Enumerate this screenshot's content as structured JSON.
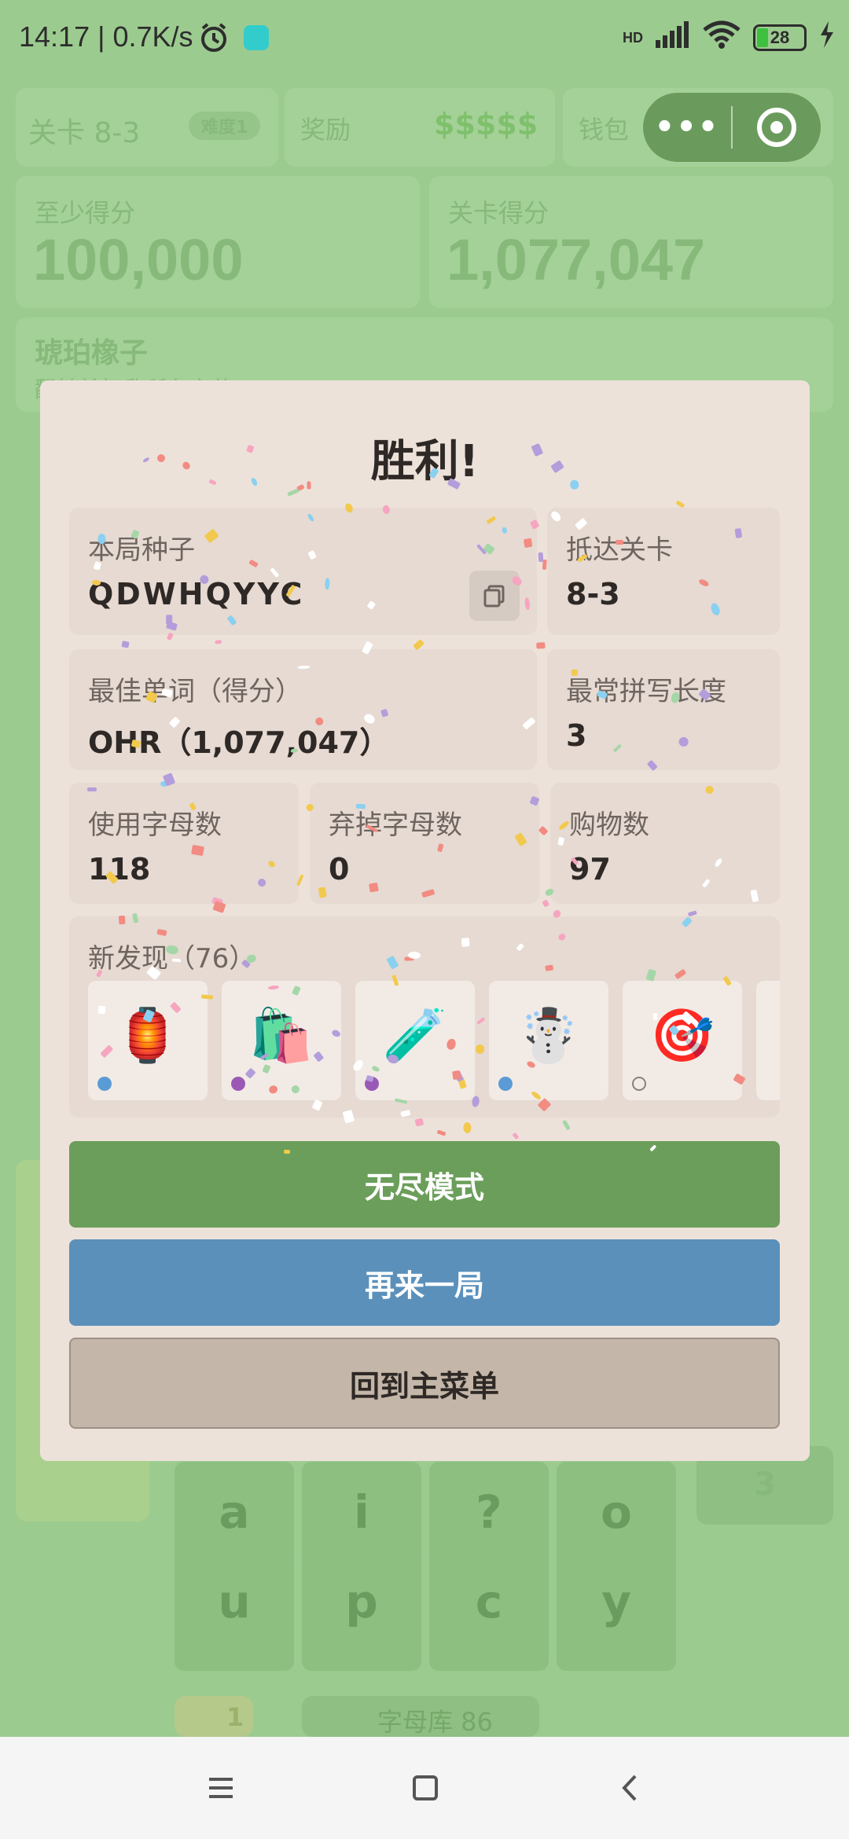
{
  "status": {
    "time": "14:17 | 0.7K/s",
    "hd": "HD",
    "battery": "28"
  },
  "background": {
    "level_label": "关卡 8-3",
    "difficulty": "难度1",
    "reward_label": "奖励",
    "reward_value": "$$$$$",
    "wallet_label": "钱包",
    "min_score_label": "至少得分",
    "min_score_value": "100,000",
    "level_score_label": "关卡得分",
    "level_score_value": "1,077,047",
    "item_name": "琥珀橡子",
    "item_desc": "翻转并打乱所有字节",
    "tiles": [
      "a",
      "i",
      "?",
      "o",
      "u",
      "p",
      "c",
      "y"
    ],
    "hint_count": "1",
    "letter_bank": "字母库 86",
    "counter": "3"
  },
  "dialog": {
    "title": "胜利!",
    "seed_label": "本局种子",
    "seed_value": "QDWHQYYC",
    "reached_label": "抵达关卡",
    "reached_value": "8-3",
    "best_word_label": "最佳单词（得分）",
    "best_word_value": "OHR（1,077,047）",
    "common_length_label": "最常拼写长度",
    "common_length_value": "3",
    "letters_used_label": "使用字母数",
    "letters_used_value": "118",
    "letters_discarded_label": "弃掉字母数",
    "letters_discarded_value": "0",
    "purchases_label": "购物数",
    "purchases_value": "97",
    "discoveries_label": "新发现（76）",
    "discoveries": [
      {
        "icon": "🏮",
        "name": "red-lantern-icon",
        "dot": "#5b9bd5"
      },
      {
        "icon": "🛍️",
        "name": "shopping-bags-icon",
        "dot": "#9b59b6"
      },
      {
        "icon": "🧪",
        "name": "test-tube-icon",
        "dot": "#9b59b6"
      },
      {
        "icon": "☃️",
        "name": "snowman-icon",
        "dot": "#5b9bd5"
      },
      {
        "icon": "🎯",
        "name": "dart-target-icon",
        "dot": "hollow"
      }
    ],
    "endless_label": "无尽模式",
    "again_label": "再来一局",
    "menu_label": "回到主菜单"
  },
  "colors": {
    "endless": "#6b9e5a",
    "again": "#5b90bb",
    "menu": "#c4b6a8"
  }
}
